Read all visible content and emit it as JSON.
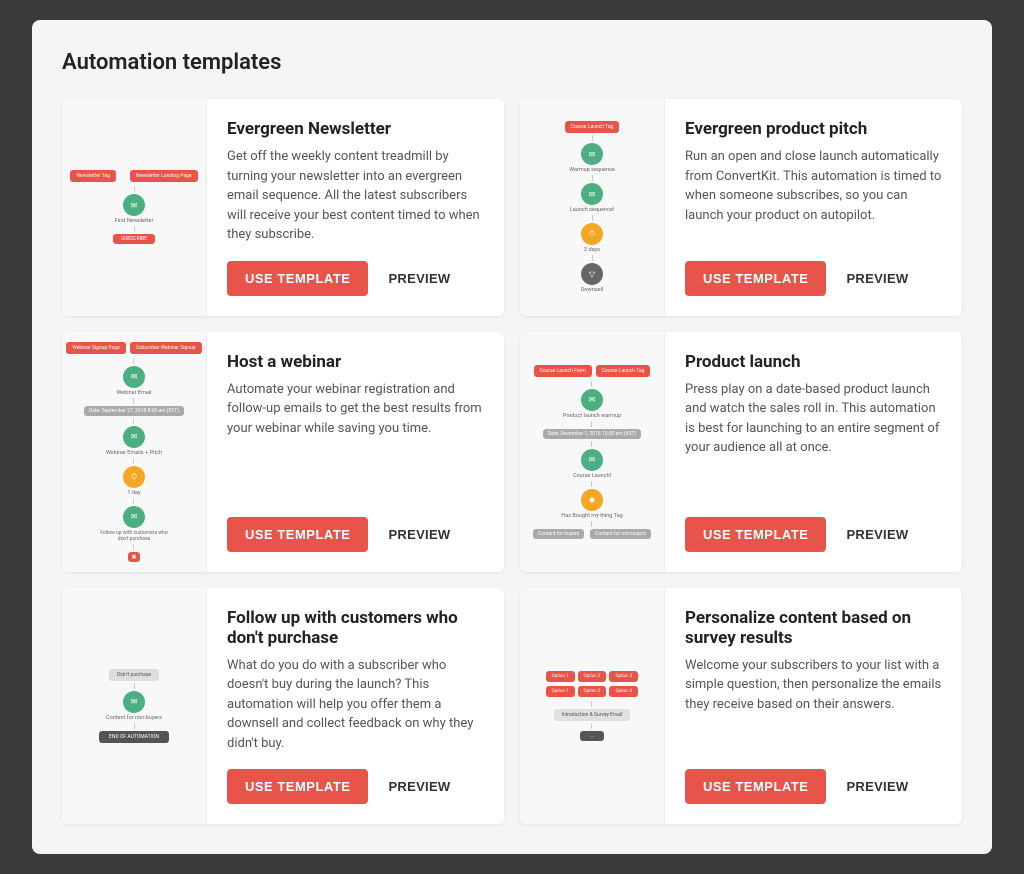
{
  "page": {
    "title": "Automation templates",
    "background_color": "#3a3a3a"
  },
  "templates": [
    {
      "id": "evergreen-newsletter",
      "title": "Evergreen Newsletter",
      "description": "Get off the weekly content treadmill by turning your newsletter into an evergreen email sequence. All the latest subscribers will receive your best content timed to when they subscribe.",
      "use_template_label": "USE TEMPLATE",
      "preview_label": "PREVIEW",
      "diagram_type": "newsletter"
    },
    {
      "id": "evergreen-product-pitch",
      "title": "Evergreen product pitch",
      "description": "Run an open and close launch automatically from ConvertKit. This automation is timed to when someone subscribes, so you can launch your product on autopilot.",
      "use_template_label": "USE TEMPLATE",
      "preview_label": "PREVIEW",
      "diagram_type": "product-pitch"
    },
    {
      "id": "host-webinar",
      "title": "Host a webinar",
      "description": "Automate your webinar registration and follow-up emails to get the best results from your webinar while saving you time.",
      "use_template_label": "USE TEMPLATE",
      "preview_label": "PREVIEW",
      "diagram_type": "webinar"
    },
    {
      "id": "product-launch",
      "title": "Product launch",
      "description": "Press play on a date-based product launch and watch the sales roll in. This automation is best for launching to an entire segment of your audience all at once.",
      "use_template_label": "USE TEMPLATE",
      "preview_label": "PREVIEW",
      "diagram_type": "launch"
    },
    {
      "id": "follow-up",
      "title": "Follow up with customers who don't purchase",
      "description": "What do you do with a subscriber who doesn't buy during the launch? This automation will help you offer them a downsell and collect feedback on why they didn't buy.",
      "use_template_label": "USE TEMPLATE",
      "preview_label": "PREVIEW",
      "diagram_type": "follow-up"
    },
    {
      "id": "survey-results",
      "title": "Personalize content based on survey results",
      "description": "Welcome your subscribers to your list with a simple question, then personalize the emails they receive based on their answers.",
      "use_template_label": "USE TEMPLATE",
      "preview_label": "PREVIEW",
      "diagram_type": "survey"
    }
  ],
  "labels": {
    "use_template": "USE TEMPLATE",
    "preview": "PREVIEW"
  }
}
